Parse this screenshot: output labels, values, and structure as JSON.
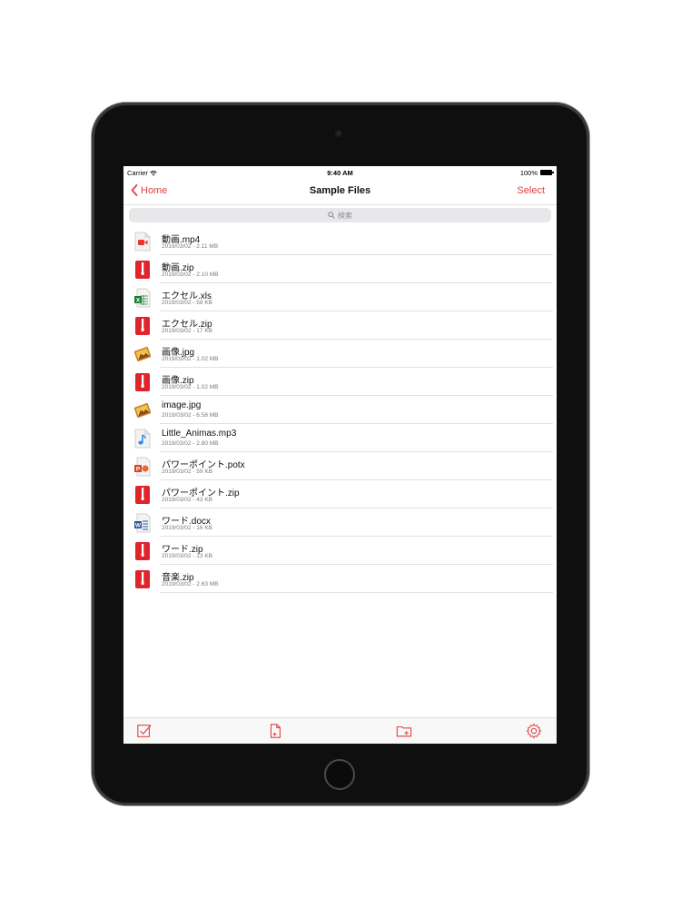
{
  "status_bar": {
    "carrier": "Carrier",
    "time": "9:40 AM",
    "battery": "100%"
  },
  "nav": {
    "back_label": "Home",
    "title": "Sample Files",
    "select_label": "Select"
  },
  "search": {
    "placeholder": "検索"
  },
  "accent_color": "#e14040",
  "files": [
    {
      "name": "動画.mp4",
      "meta": "2019/03/02 - 2.11 MB",
      "icon": "video-file-icon"
    },
    {
      "name": "動画.zip",
      "meta": "2019/03/02 - 2.10 MB",
      "icon": "zip-file-icon"
    },
    {
      "name": "エクセル.xls",
      "meta": "2019/03/02 - 58 KB",
      "icon": "excel-file-icon"
    },
    {
      "name": "エクセル.zip",
      "meta": "2019/03/02 - 17 KB",
      "icon": "zip-file-icon"
    },
    {
      "name": "画像.jpg",
      "meta": "2019/03/02 - 1.02 MB",
      "icon": "image-file-icon"
    },
    {
      "name": "画像.zip",
      "meta": "2019/03/02 - 1.02 MB",
      "icon": "zip-file-icon"
    },
    {
      "name": "image.jpg",
      "meta": "2019/03/02 - 6.58 MB",
      "icon": "image-file-icon"
    },
    {
      "name": "Little_Animas.mp3",
      "meta": "2019/03/02 - 2.80 MB",
      "icon": "music-file-icon"
    },
    {
      "name": "パワーポイント.potx",
      "meta": "2019/03/02 - 59 KB",
      "icon": "powerpoint-file-icon"
    },
    {
      "name": "パワーポイント.zip",
      "meta": "2019/03/02 - 43 KB",
      "icon": "zip-file-icon"
    },
    {
      "name": "ワード.docx",
      "meta": "2019/03/02 - 16 KB",
      "icon": "word-file-icon"
    },
    {
      "name": "ワード.zip",
      "meta": "2019/03/02 - 13 KB",
      "icon": "zip-file-icon"
    },
    {
      "name": "音楽.zip",
      "meta": "2019/03/02 - 2.63 MB",
      "icon": "zip-file-icon"
    }
  ],
  "toolbar": {
    "items": [
      "checklist-icon",
      "new-file-icon",
      "new-folder-icon",
      "gear-icon"
    ]
  }
}
